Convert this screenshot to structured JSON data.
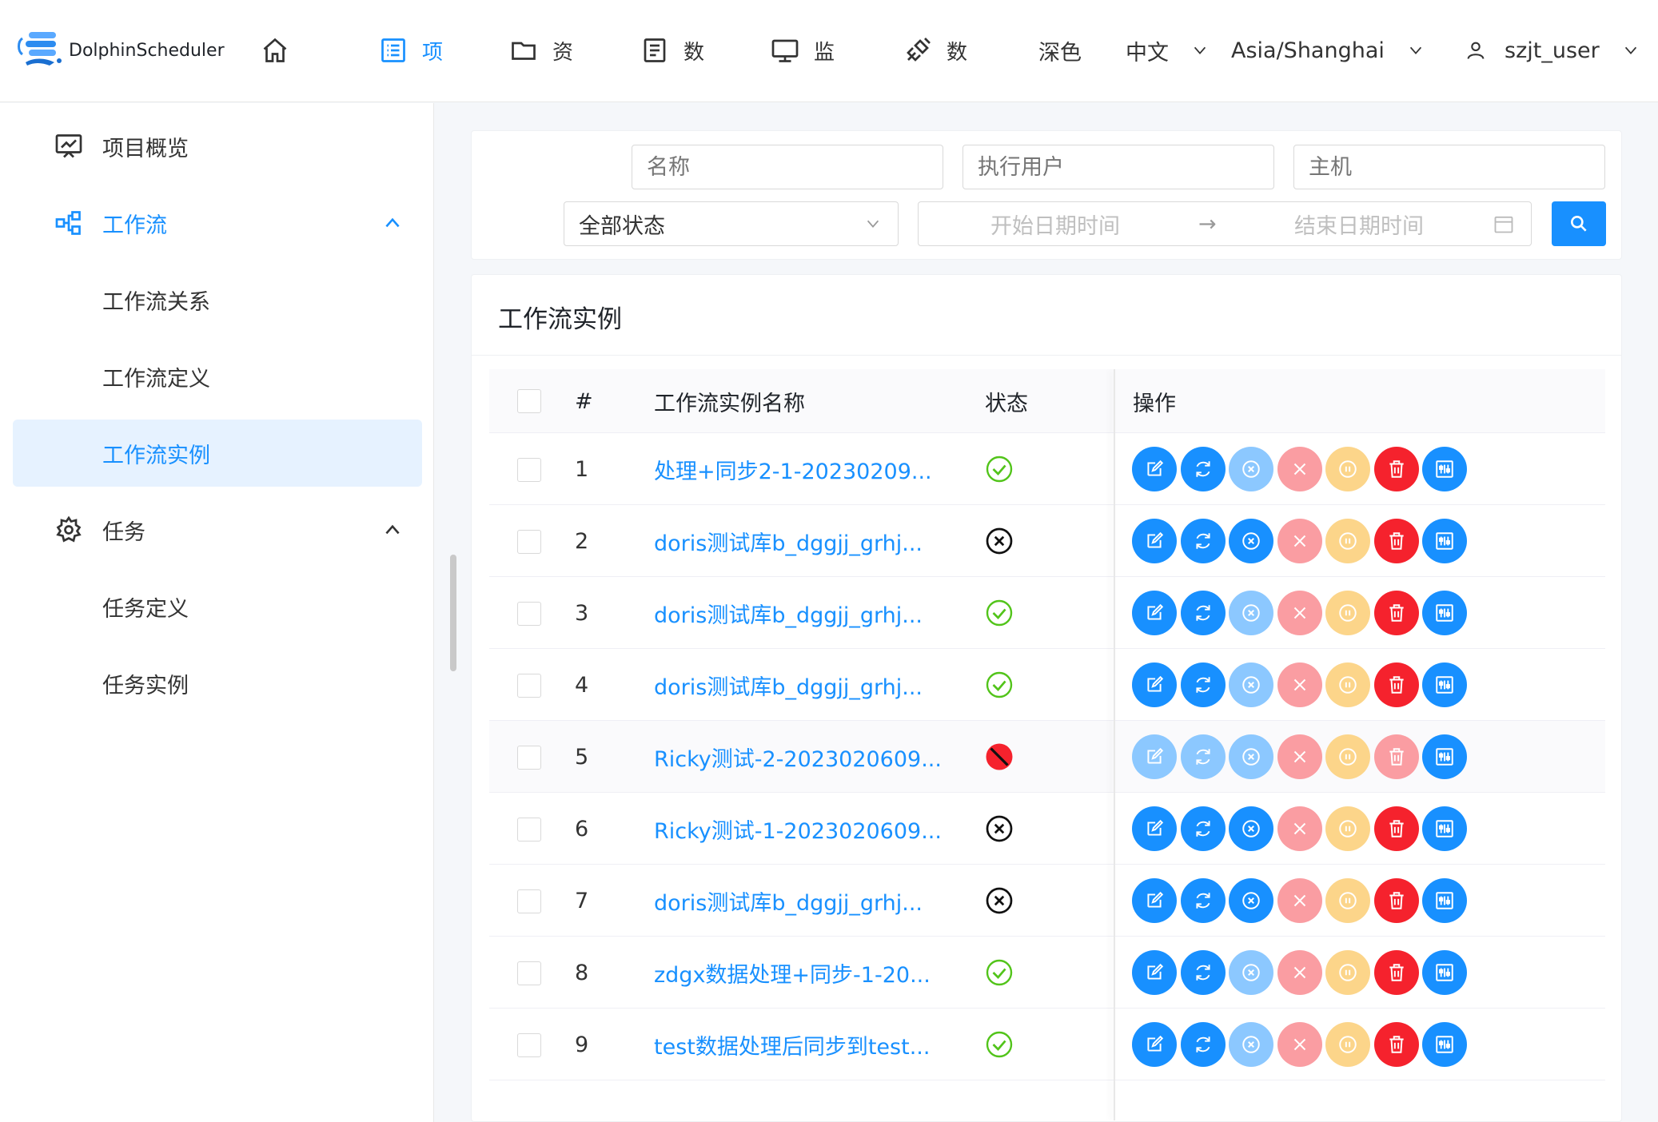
{
  "header": {
    "app_name": "DolphinScheduler",
    "nav": [
      {
        "icon": "home-icon",
        "label": ""
      },
      {
        "icon": "project-list-icon",
        "label": "项",
        "active": true
      },
      {
        "icon": "folder-icon",
        "label": "资"
      },
      {
        "icon": "data-document-icon",
        "label": "数"
      },
      {
        "icon": "monitor-icon",
        "label": "监"
      },
      {
        "icon": "datasource-link-icon",
        "label": "数"
      }
    ],
    "theme": "深色",
    "language": "中文",
    "timezone": "Asia/Shanghai",
    "user": "szjt_user"
  },
  "sidebar": {
    "items": [
      {
        "label": "项目概览",
        "icon": "presentation-chart-icon"
      },
      {
        "label": "工作流",
        "icon": "workflow-icon",
        "expanded": true
      },
      {
        "label": "工作流关系"
      },
      {
        "label": "工作流定义"
      },
      {
        "label": "工作流实例",
        "selected": true
      },
      {
        "label": "任务",
        "icon": "gear-icon",
        "expanded": true
      },
      {
        "label": "任务定义"
      },
      {
        "label": "任务实例"
      }
    ]
  },
  "search": {
    "name_placeholder": "名称",
    "executor_placeholder": "执行用户",
    "host_placeholder": "主机",
    "state_value": "全部状态",
    "start_placeholder": "开始日期时间",
    "end_placeholder": "结束日期时间",
    "range_separator": "→"
  },
  "table": {
    "title": "工作流实例",
    "columns": {
      "index": "#",
      "name": "工作流实例名称",
      "state": "状态",
      "operation": "操作"
    },
    "rows": [
      {
        "index": "1",
        "name": "处理+同步2-1-20230209...",
        "state": "success",
        "enabled": [
          1,
          1,
          0,
          0,
          0,
          1,
          1
        ]
      },
      {
        "index": "2",
        "name": "doris测试库b_dggjj_grhj...",
        "state": "failure",
        "enabled": [
          1,
          1,
          1,
          0,
          0,
          1,
          1
        ]
      },
      {
        "index": "3",
        "name": "doris测试库b_dggjj_grhj...",
        "state": "success",
        "enabled": [
          1,
          1,
          0,
          0,
          0,
          1,
          1
        ]
      },
      {
        "index": "4",
        "name": "doris测试库b_dggjj_grhj...",
        "state": "success",
        "enabled": [
          1,
          1,
          0,
          0,
          0,
          1,
          1
        ]
      },
      {
        "index": "5",
        "name": "Ricky测试-2-2023020609...",
        "state": "stop",
        "enabled": [
          0,
          0,
          0,
          0,
          0,
          0,
          1
        ]
      },
      {
        "index": "6",
        "name": "Ricky测试-1-2023020609...",
        "state": "failure",
        "enabled": [
          1,
          1,
          1,
          0,
          0,
          1,
          1
        ]
      },
      {
        "index": "7",
        "name": "doris测试库b_dggjj_grhj...",
        "state": "failure",
        "enabled": [
          1,
          1,
          1,
          0,
          0,
          1,
          1
        ]
      },
      {
        "index": "8",
        "name": "zdgx数据处理+同步-1-20...",
        "state": "success",
        "enabled": [
          1,
          1,
          0,
          0,
          0,
          1,
          1
        ]
      },
      {
        "index": "9",
        "name": "test数据处理后同步到test...",
        "state": "success",
        "enabled": [
          1,
          1,
          0,
          0,
          0,
          1,
          1
        ]
      }
    ],
    "operations": [
      {
        "name": "edit-button",
        "icon": "edit-icon",
        "color": "#1890ff",
        "disabled_color": "#8cc8ff"
      },
      {
        "name": "rerun-button",
        "icon": "refresh-icon",
        "color": "#1890ff",
        "disabled_color": "#8cc8ff"
      },
      {
        "name": "recover-failed-button",
        "icon": "circle-x-icon",
        "color": "#1890ff",
        "disabled_color": "#8cc8ff"
      },
      {
        "name": "stop-button",
        "icon": "close-icon",
        "color": "#f5222d",
        "disabled_color": "#fa9da2"
      },
      {
        "name": "pause-button",
        "icon": "pause-circle-icon",
        "color": "#faad14",
        "disabled_color": "#fcd58a"
      },
      {
        "name": "delete-button",
        "icon": "trash-icon",
        "color": "#f5222d",
        "disabled_color": "#fa9da2"
      },
      {
        "name": "gantt-button",
        "icon": "gantt-chart-icon",
        "color": "#1890ff",
        "disabled_color": "#8cc8ff"
      }
    ]
  },
  "colors": {
    "primary": "#1890ff",
    "success": "#52c41a",
    "danger": "#f5222d",
    "warning": "#faad14"
  }
}
